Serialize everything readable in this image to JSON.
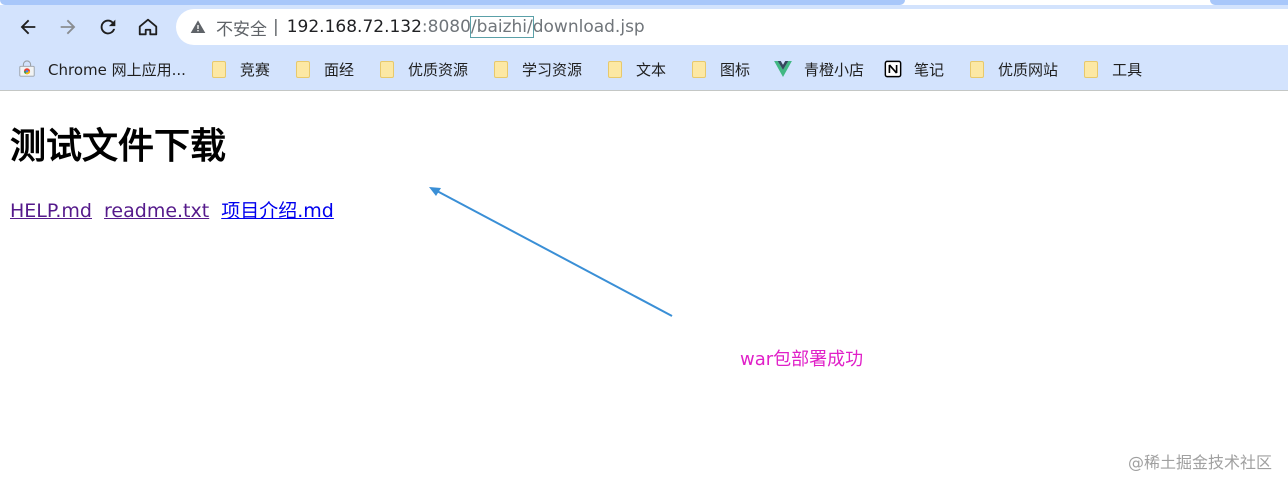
{
  "browser": {
    "security_label": "不安全",
    "separator": "|",
    "url": {
      "host": "192.168.72.132",
      "port": ":8080",
      "highlighted": "/baizhi/",
      "rest": "download.jsp"
    },
    "bookmarks": [
      {
        "label": "Chrome 网上应用...",
        "icon": "chrome-webstore-icon"
      },
      {
        "label": "竞赛",
        "icon": "folder-icon"
      },
      {
        "label": "面经",
        "icon": "folder-icon"
      },
      {
        "label": "优质资源",
        "icon": "folder-icon"
      },
      {
        "label": "学习资源",
        "icon": "folder-icon"
      },
      {
        "label": "文本",
        "icon": "folder-icon"
      },
      {
        "label": "图标",
        "icon": "folder-icon"
      },
      {
        "label": "青橙小店",
        "icon": "vue-icon"
      },
      {
        "label": "笔记",
        "icon": "notion-icon"
      },
      {
        "label": "优质网站",
        "icon": "folder-icon"
      },
      {
        "label": "工具",
        "icon": "folder-icon"
      }
    ]
  },
  "page": {
    "title": "测试文件下载",
    "links": [
      {
        "label": "HELP.md",
        "visited": true
      },
      {
        "label": "readme.txt",
        "visited": true
      },
      {
        "label": "项目介绍.md",
        "visited": false
      }
    ]
  },
  "annotation": {
    "text": "war包部署成功",
    "color": "#e020c8",
    "arrow_color": "#3a8fd6"
  },
  "watermark": "@稀土掘金技术社区"
}
